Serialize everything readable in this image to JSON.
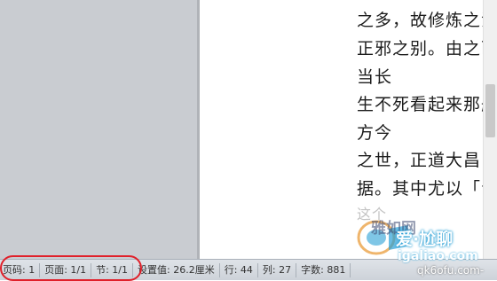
{
  "document": {
    "lines": [
      "之多，故修炼之法",
      "正邪之别。由之而",
      "当长",
      "生不死看起来那般",
      "方今",
      "之世，正道大昌，",
      "据。其中尤以「青",
      "这个"
    ]
  },
  "statusbar": {
    "page_code": "页码: 1",
    "page": "页面: 1/1",
    "section": "节: 1/1",
    "setting": "设置值: 26.2厘米",
    "row": "行: 44",
    "column": "列: 27",
    "word_count": "字数: 881"
  },
  "watermarks": {
    "brand": "雅如网",
    "cn_text": "爱·尬聊",
    "url": "igaliao.com",
    "url2": "qk6ofu.com-"
  },
  "colors": {
    "annotation": "#e0202a",
    "watermark_glow": "#2aa0d6"
  }
}
